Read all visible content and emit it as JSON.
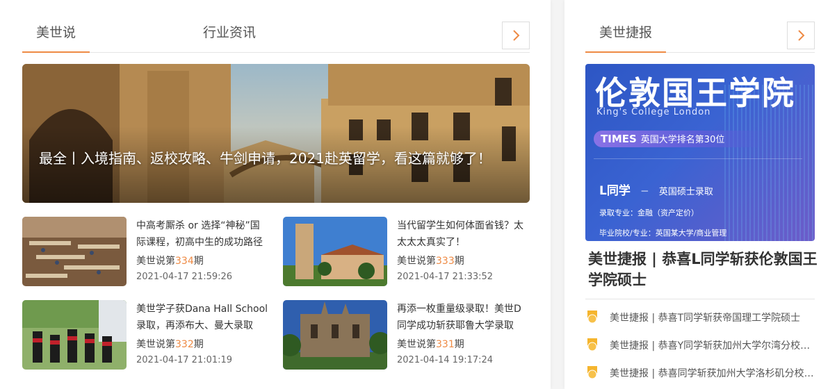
{
  "left_panel": {
    "tabs": [
      "美世说",
      "行业资讯"
    ],
    "hero_caption": "最全丨入境指南、返校攻略、牛剑申请，2021赴英留学，看这篇就够了！",
    "articles": [
      {
        "title": "中高考厮杀 or 选择“神秘”国际课程，初高中生的成功路径",
        "issue_prefix": "美世说第",
        "issue_number": "334",
        "issue_suffix": "期",
        "date": "2021-04-17 21:59:26"
      },
      {
        "title": "当代留学生如何体面省钱？太太太太真实了！",
        "issue_prefix": "美世说第",
        "issue_number": "333",
        "issue_suffix": "期",
        "date": "2021-04-17 21:33:52"
      },
      {
        "title": "美世学子获Dana Hall School录取，再添布大、曼大录取",
        "issue_prefix": "美世说第",
        "issue_number": "332",
        "issue_suffix": "期",
        "date": "2021-04-17 21:01:19"
      },
      {
        "title": "再添一枚重量级录取！美世D同学成功斩获耶鲁大学录取",
        "issue_prefix": "美世说第",
        "issue_number": "331",
        "issue_suffix": "期",
        "date": "2021-04-14 19:17:24"
      }
    ]
  },
  "right_panel": {
    "tab": "美世捷报",
    "promo": {
      "title": "伦敦国王学院",
      "subtitle": "King's College London",
      "rank_badge": "TIMES",
      "rank_text": "英国大学排名第30位",
      "student": "L同学",
      "dash": "－",
      "result": "英国硕士录取",
      "major": "录取专业：金融（资产定价）",
      "school": "毕业院校/专业：英国某大学/商业管理"
    },
    "feature_title": "美世捷报 | 恭喜L同学斩获伦敦国王学院硕士",
    "news": [
      "美世捷报 | 恭喜T同学斩获帝国理工学院硕士",
      "美世捷报 | 恭喜Y同学斩获加州大学尔湾分校硕士",
      "美世捷报 | 恭喜同学斩获加州大学洛杉矶分校硕士"
    ]
  },
  "colors": {
    "accent": "#ee8a44",
    "promo_blue": "#3a63d2",
    "medal": "#f5b52e"
  }
}
